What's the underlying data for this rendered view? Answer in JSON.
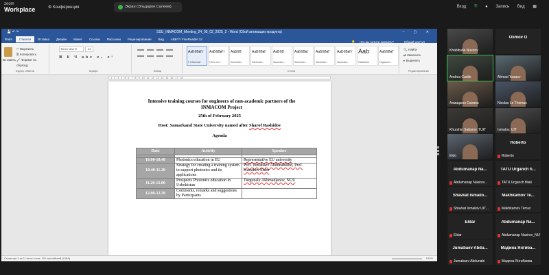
{
  "zoom": {
    "logo_line1": "zoom",
    "logo_line2": "Workplace",
    "conference_label": "Конференция",
    "screen_share_label": "Экран (Эльдарон Салеем)",
    "right": {
      "login": "Вход",
      "record": "Запись",
      "view": "Вид"
    },
    "colors": {
      "active_dot": "#3bb34a",
      "mic_muted": "#d33d3d"
    }
  },
  "word": {
    "title": "SSU_INMACOM_Meeting_24_05_02_2025_2 - Word (Сбой активации продукта)",
    "tabs": [
      "Файл",
      "Главная",
      "Вставка",
      "Дизайн",
      "Макет",
      "Ссылки",
      "Рассылки",
      "Рецензирование",
      "Вид",
      "ABBYY FineReader 12"
    ],
    "active_tab": "Главная",
    "help": "Что вы хотите сделать?",
    "share": "Общий доступ",
    "clipboard": {
      "paste": "Вставить",
      "cut": "Вырезать",
      "copy": "Копировать",
      "format_painter": "Формат по образцу",
      "caption": "Буфер обмена"
    },
    "font": {
      "name": "Times New R",
      "size": "14",
      "caption": "Шрифт",
      "format_buttons": "Ж К Ч abc x₂ x²"
    },
    "paragraph_caption": "Абзац",
    "styles": [
      {
        "preview": "АаБбВвГг",
        "name": "¶ Обычный"
      },
      {
        "preview": "АаБбВвГг",
        "name": "¶ Без инт..."
      },
      {
        "preview": "АаБбВ",
        "name": "Заголово..."
      },
      {
        "preview": "АаБбВвГ",
        "name": "Заголово..."
      },
      {
        "preview": "АаБбВ",
        "name": "Заголово..."
      },
      {
        "preview": "АаБбВвI",
        "name": "Заголово..."
      },
      {
        "preview": "АаБбВвГ",
        "name": "Заголово..."
      },
      {
        "preview": "АаБбВвГг",
        "name": "Заголово..."
      },
      {
        "preview": "Aab",
        "name": "Название"
      },
      {
        "preview": "АаБбВвГ",
        "name": "Подзагол..."
      }
    ],
    "styles_caption": "Стили",
    "editing": {
      "find": "Найти",
      "replace": "Заменить",
      "select": "Выделить",
      "caption": "Редактирование"
    },
    "status_left": "Страница 1 из 1   Число слов: 101   английский (США)",
    "zoom_level": "100%"
  },
  "document": {
    "title": "Intensive training courses for engineers of non-academic partners of the INMACOM Project",
    "date": "25th of February 2025",
    "host_prefix": "Host: Samarkand State University named after ",
    "host_name": "Sharof Rashidov",
    "agenda_heading": "Agenda",
    "table": {
      "headers": [
        "Date",
        "Activity",
        "Speaker"
      ],
      "rows": [
        {
          "date": "10.00-10.40",
          "activity": "Photonics education in EU",
          "speaker": "Representative EU university"
        },
        {
          "date": "10.40-11.20",
          "activity": "Strategy for creating a training system to support photonics and its applications",
          "speaker": "Prof. Jumabaev Abdunabikhd, Prof. Kurtaliev Eldor"
        },
        {
          "date": "11.20-12.00",
          "activity": "Prospects Photonics education in Uzbekistan",
          "speaker": "Turgunaly Akhmadjanov, NUU"
        },
        {
          "date": "12.00-12.30",
          "activity": "Comments, remarks and suggestions by Participants",
          "speaker": ""
        }
      ]
    }
  },
  "participants": [
    {
      "name": "Khabibullo Nosirov",
      "type": "video"
    },
    {
      "name": "Olimov O",
      "type": "name"
    },
    {
      "name": "Andrea Carlile",
      "type": "video"
    },
    {
      "name": "Ahmad Yasaov",
      "type": "video"
    },
    {
      "name": "Ахмаджон Сапиев",
      "type": "video"
    },
    {
      "name": "Nicolas Le Thomas",
      "type": "video"
    },
    {
      "name": "Khurshid Sattarov, TUIT",
      "type": "video"
    },
    {
      "name": "Ismatov, UIT",
      "type": "video"
    },
    {
      "name": "Eldo",
      "type": "video"
    },
    {
      "name": "Roberto",
      "type": "name",
      "label": "Roberto"
    },
    {
      "name": "Abdumanap Nasirov...",
      "type": "name",
      "label": "Abdumanap Na..."
    },
    {
      "name": "TATU Urganch filiali",
      "type": "name",
      "label": "TATU Urganch fi..."
    },
    {
      "name": "Shavkat Ismailov UIT...",
      "type": "name",
      "label": "Shavkat Ismailo..."
    },
    {
      "name": "Makhkamov Temur",
      "type": "name",
      "label": "Makhkamov Te..."
    },
    {
      "name": "Eldar",
      "type": "name",
      "label": "Eldar"
    },
    {
      "name": "Abdumanap Nasirov_NUU",
      "type": "name",
      "label": "Abdumanap Na..."
    },
    {
      "name": "Jumabaev Abdunabi",
      "type": "name",
      "label": "Jumabaev Abdu..."
    },
    {
      "name": "Мадина Янгибаева",
      "type": "name",
      "label": "Мадина Янгиба..."
    }
  ]
}
